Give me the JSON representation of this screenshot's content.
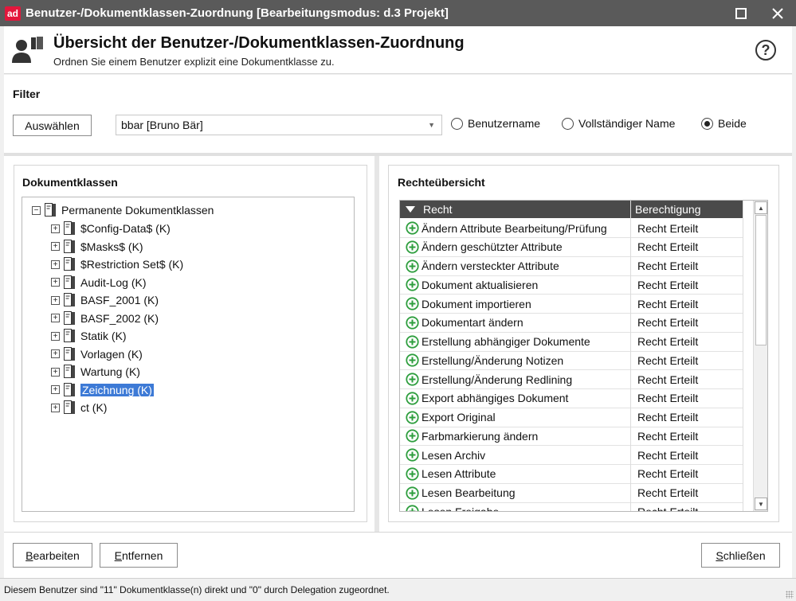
{
  "window": {
    "logo": "ad",
    "title": "Benutzer-/Dokumentklassen-Zuordnung [Bearbeitungsmodus: d.3 Projekt]"
  },
  "header": {
    "title": "Übersicht der Benutzer-/Dokumentklassen-Zuordnung",
    "subtitle": "Ordnen Sie einem Benutzer explizit eine Dokumentklasse zu.",
    "help": "?"
  },
  "filter": {
    "label": "Filter",
    "select_button": "Auswählen",
    "user_value": "bbar [Bruno Bär]",
    "radios": [
      {
        "label": "Benutzername",
        "checked": false
      },
      {
        "label": "Vollständiger Name",
        "checked": false
      },
      {
        "label": "Beide",
        "checked": true
      }
    ]
  },
  "doc_classes": {
    "title": "Dokumentklassen",
    "root": "Permanente Dokumentklassen",
    "items": [
      "$Config-Data$ (K)",
      "$Masks$ (K)",
      "$Restriction Set$ (K)",
      "Audit-Log (K)",
      "BASF_2001 (K)",
      "BASF_2002 (K)",
      "Statik (K)",
      "Vorlagen (K)",
      "Wartung (K)",
      "Zeichnung (K)",
      "ct (K)"
    ],
    "selected_index": 9
  },
  "rights": {
    "title": "Rechteübersicht",
    "columns": [
      "Recht",
      "Berechtigung"
    ],
    "rows": [
      {
        "right": "Ändern Attribute Bearbeitung/Prüfung",
        "permission": "Recht Erteilt"
      },
      {
        "right": "Ändern geschützter Attribute",
        "permission": "Recht Erteilt"
      },
      {
        "right": "Ändern versteckter Attribute",
        "permission": "Recht Erteilt"
      },
      {
        "right": "Dokument aktualisieren",
        "permission": "Recht Erteilt"
      },
      {
        "right": "Dokument importieren",
        "permission": "Recht Erteilt"
      },
      {
        "right": "Dokumentart ändern",
        "permission": "Recht Erteilt"
      },
      {
        "right": "Erstellung abhängiger Dokumente",
        "permission": "Recht Erteilt"
      },
      {
        "right": "Erstellung/Änderung Notizen",
        "permission": "Recht Erteilt"
      },
      {
        "right": "Erstellung/Änderung Redlining",
        "permission": "Recht Erteilt"
      },
      {
        "right": "Export abhängiges Dokument",
        "permission": "Recht Erteilt"
      },
      {
        "right": "Export Original",
        "permission": "Recht Erteilt"
      },
      {
        "right": "Farbmarkierung ändern",
        "permission": "Recht Erteilt"
      },
      {
        "right": "Lesen Archiv",
        "permission": "Recht Erteilt"
      },
      {
        "right": "Lesen Attribute",
        "permission": "Recht Erteilt"
      },
      {
        "right": "Lesen Bearbeitung",
        "permission": "Recht Erteilt"
      },
      {
        "right": "Lesen Freigabe",
        "permission": "Recht Erteilt"
      }
    ]
  },
  "footer": {
    "edit": {
      "first": "B",
      "rest": "earbeiten"
    },
    "remove": {
      "first": "E",
      "rest": "ntfernen"
    },
    "close": {
      "first": "S",
      "rest": "chließen"
    }
  },
  "status": "Diesem Benutzer sind \"11\" Dokumentklasse(n) direkt und \"0\" durch Delegation zugeordnet.",
  "colors": {
    "accent": "#e3173c",
    "selection": "#3d7ad6",
    "grant": "#2e9e3e"
  }
}
